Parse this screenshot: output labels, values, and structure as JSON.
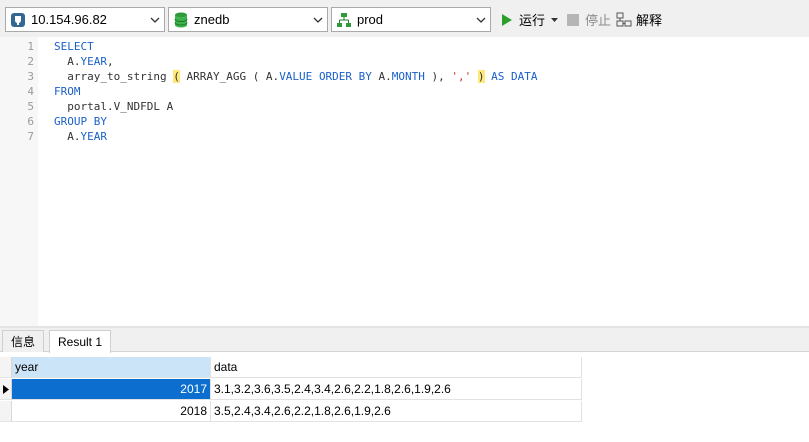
{
  "toolbar": {
    "connection": {
      "value": "10.154.96.82",
      "icon": "elephant-db-icon"
    },
    "database": {
      "value": "znedb",
      "icon": "database-icon"
    },
    "schema": {
      "value": "prod",
      "icon": "schema-icon"
    },
    "run_label": "运行",
    "stop_label": "停止",
    "explain_label": "解释"
  },
  "editor": {
    "line_numbers": [
      "1",
      "2",
      "3",
      "4",
      "5",
      "6",
      "7"
    ],
    "lines": [
      [
        {
          "t": "SELECT",
          "c": "kw"
        }
      ],
      [
        {
          "t": "  A.",
          "c": "tx"
        },
        {
          "t": "YEAR",
          "c": "kw"
        },
        {
          "t": ",",
          "c": "tx"
        }
      ],
      [
        {
          "t": "  array_to_string ",
          "c": "tx"
        },
        {
          "t": "(",
          "c": "bracket"
        },
        {
          "t": " ARRAY_AGG ( A.",
          "c": "tx"
        },
        {
          "t": "VALUE",
          "c": "kw"
        },
        {
          "t": " ",
          "c": "tx"
        },
        {
          "t": "ORDER BY",
          "c": "kw"
        },
        {
          "t": " A.",
          "c": "tx"
        },
        {
          "t": "MONTH",
          "c": "kw"
        },
        {
          "t": " ), ",
          "c": "tx"
        },
        {
          "t": "','",
          "c": "str"
        },
        {
          "t": " ",
          "c": "tx"
        },
        {
          "t": ")",
          "c": "bracket"
        },
        {
          "t": " ",
          "c": "tx"
        },
        {
          "t": "AS DATA",
          "c": "kw"
        }
      ],
      [
        {
          "t": "FROM",
          "c": "kw"
        }
      ],
      [
        {
          "t": "  portal.V_NDFDL A",
          "c": "tx"
        }
      ],
      [
        {
          "t": "GROUP BY",
          "c": "kw"
        }
      ],
      [
        {
          "t": "  A.",
          "c": "tx"
        },
        {
          "t": "YEAR",
          "c": "kw"
        }
      ]
    ]
  },
  "result_tabs": [
    {
      "label": "信息",
      "active": false
    },
    {
      "label": "Result 1",
      "active": true
    }
  ],
  "grid": {
    "columns": [
      "year",
      "data"
    ],
    "rows": [
      {
        "year": "2017",
        "data": "3.1,3.2,3.6,3.5,2.4,3.4,2.6,2.2,1.8,2.6,1.9,2.6",
        "selected": true
      },
      {
        "year": "2018",
        "data": "3.5,2.4,3.4,2.6,2.2,1.8,2.6,1.9,2.6",
        "selected": false
      }
    ]
  },
  "colors": {
    "keyword": "#1a60c8",
    "string": "#c0392b",
    "bracket_highlight": "#ffe87a",
    "selection": "#0c6fcf",
    "header_highlight": "#cce4f7",
    "run_green": "#2aa02a"
  }
}
